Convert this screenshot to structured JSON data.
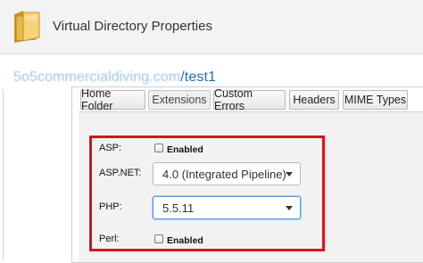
{
  "header": {
    "title": "Virtual Directory Properties",
    "icon": "folder-icon"
  },
  "site": {
    "domain_blurred": "5o5commercialdiving.com",
    "path": "/test1"
  },
  "tabs": [
    {
      "label": "Home Folder",
      "active": false
    },
    {
      "label": "Extensions",
      "active": true
    },
    {
      "label": "Custom Errors",
      "active": false
    },
    {
      "label": "Headers",
      "active": false
    },
    {
      "label": "MIME Types",
      "active": false
    }
  ],
  "settings": {
    "asp": {
      "label": "ASP:",
      "checkbox_label": "Enabled",
      "checked": false
    },
    "aspnet": {
      "label": "ASP.NET:",
      "value": "4.0 (Integrated Pipeline)"
    },
    "php": {
      "label": "PHP:",
      "value": "5.5.11"
    },
    "perl": {
      "label": "Perl:",
      "checkbox_label": "Enabled",
      "checked": false
    }
  },
  "colors": {
    "highlight_border": "#d4161b",
    "link": "#1f6fae"
  }
}
